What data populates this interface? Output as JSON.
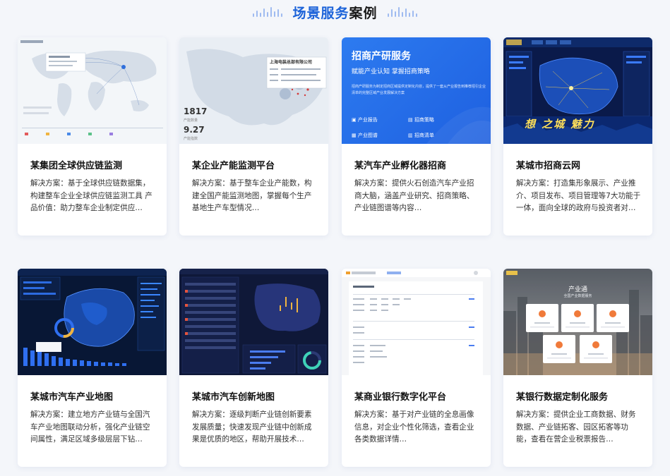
{
  "section": {
    "title_highlight": "场景服务",
    "title_rest": "案例"
  },
  "cards": [
    {
      "title": "某集团全球供应链监测",
      "desc": "解决方案：基于全球供应链数据集，构建整车企业全球供应链监测工具 产品价值：助力整车企业制定供应…"
    },
    {
      "title": "某企业产能监测平台",
      "desc": "解决方案：基于整车企业产能数，构建全国产能监测地图，掌握每个生产基地生产车型情况…",
      "thumb": {
        "company": "上海电装总部有限公司",
        "stat1": "1817",
        "stat1_label": "产能数量",
        "stat2": "9.27",
        "stat2_label": "产能指数"
      }
    },
    {
      "title": "某汽车产业孵化器招商",
      "desc": "解决方案：提供火石创造汽车产业招商大脑，涵盖产业研究、招商策略、产业链图谱等内容…",
      "thumb": {
        "heading": "招商产研服务",
        "subheading": "赋能产业认知 掌握招商策略",
        "body": "招商产研服务为制定招商区域提供定制化内容，提供了一套从产业报告到推荐招引企业清单的完整区域产业发展解决方案",
        "items": [
          "产业报告",
          "招商策略",
          "产业图谱",
          "招商清单"
        ]
      }
    },
    {
      "title": "某城市招商云网",
      "desc": "解决方案：打造集形象展示、产业推介、项目发布、项目管理等7大功能于一体，面向全球的政府与投资者对…",
      "thumb": {
        "slogan": "想 之城 魅力"
      }
    },
    {
      "title": "某城市汽车产业地图",
      "desc": "解决方案：建立地方产业链与全国汽车产业地图联动分析，强化产业链空间属性，满足区域多级层层下钻…"
    },
    {
      "title": "某城市汽车创新地图",
      "desc": "解决方案：逐级判断产业链创新要素发展质量；快速发现产业链中创新成果是优质的地区，帮助开展技术…"
    },
    {
      "title": "某商业银行数字化平台",
      "desc": "解决方案：基于对产业链的全息画像信息，对企业个性化筛选，查看企业各类数据详情…"
    },
    {
      "title": "某银行数据定制化服务",
      "desc": "解决方案：提供企业工商数据、财务数据、产业链拓客、园区拓客等功能，查看在营企业税票报告…",
      "thumb": {
        "heading": "产业通",
        "subheading": "全国产业数据服务"
      }
    }
  ]
}
